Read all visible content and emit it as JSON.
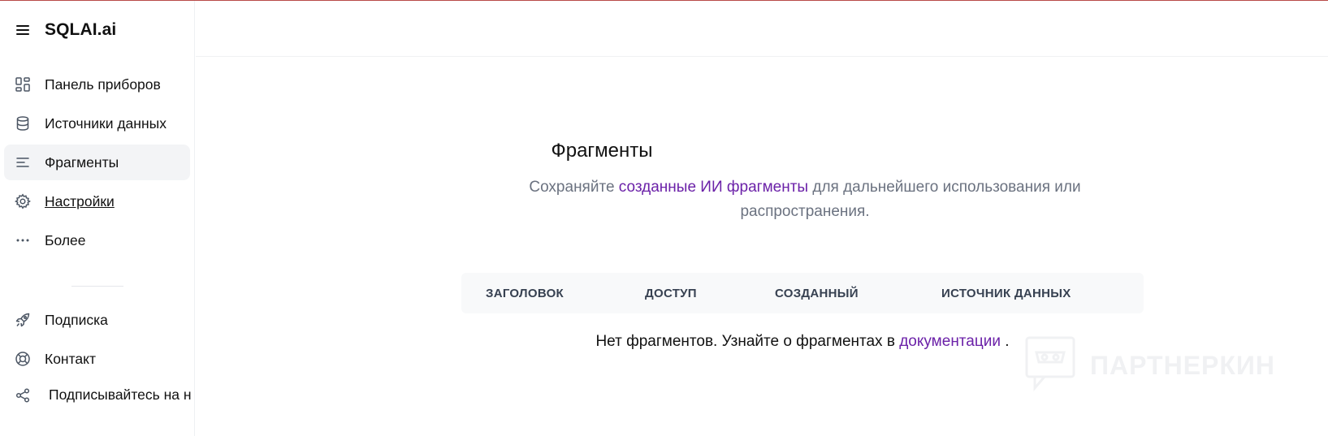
{
  "app": {
    "title": "SQLAI.ai"
  },
  "sidebar": {
    "items": [
      {
        "label": "Панель приборов",
        "icon": "dashboard-icon"
      },
      {
        "label": "Источники данных",
        "icon": "database-icon"
      },
      {
        "label": "Фрагменты",
        "icon": "list-icon",
        "active": true
      },
      {
        "label": "Настройки",
        "icon": "gear-icon"
      },
      {
        "label": "Более",
        "icon": "more-icon"
      }
    ],
    "bottom_items": [
      {
        "label": "Подписка",
        "icon": "rocket-icon"
      },
      {
        "label": "Контакт",
        "icon": "lifebuoy-icon"
      },
      {
        "label": "Подписывайтесь на н",
        "icon": "share-icon"
      }
    ]
  },
  "main": {
    "title": "Фрагменты",
    "subtitle_prefix": "Сохраняйте ",
    "subtitle_link": "созданные ИИ фрагменты",
    "subtitle_suffix": " для дальнейшего использования или распространения.",
    "table": {
      "columns": [
        "ЗАГОЛОВОК",
        "ДОСТУП",
        "СОЗДАННЫЙ",
        "ИСТОЧНИК ДАННЫХ"
      ]
    },
    "empty_prefix": "Нет фрагментов. Узнайте о фрагментах в ",
    "empty_link": "документации",
    "empty_suffix": " ."
  },
  "watermark": {
    "text": "ПАРТНЕРКИН"
  },
  "colors": {
    "accent": "#6b21a8",
    "muted": "#6b7280",
    "active_bg": "#f3f4f6"
  }
}
